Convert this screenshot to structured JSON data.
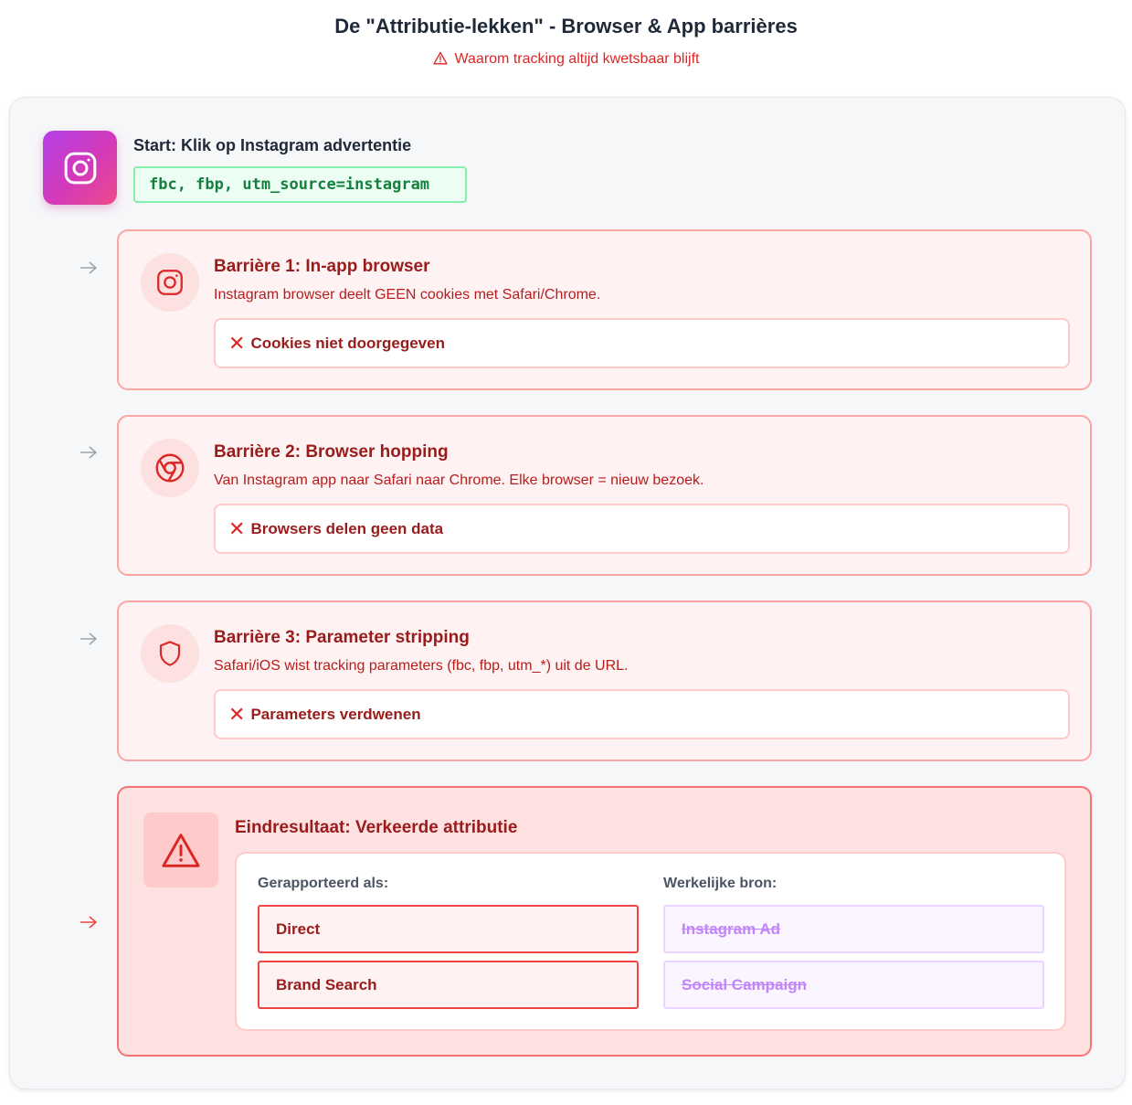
{
  "header": {
    "title": "De \"Attributie-lekken\" - Browser & App barrières",
    "subtitle": "Waarom tracking altijd kwetsbaar blijft"
  },
  "start": {
    "title": "Start: Klik op Instagram advertentie",
    "params": "fbc, fbp, utm_source=instagram",
    "icon": "instagram-icon"
  },
  "barriers": [
    {
      "title": "Barrière 1: In-app browser",
      "description": "Instagram browser deelt GEEN cookies met Safari/Chrome.",
      "result": "Cookies niet doorgegeven",
      "icon": "instagram-icon"
    },
    {
      "title": "Barrière 2: Browser hopping",
      "description": "Van Instagram app naar Safari naar Chrome. Elke browser = nieuw bezoek.",
      "result": "Browsers delen geen data",
      "icon": "chrome-icon"
    },
    {
      "title": "Barrière 3: Parameter stripping",
      "description": "Safari/iOS wist tracking parameters (fbc, fbp, utm_*) uit de URL.",
      "result": "Parameters verdwenen",
      "icon": "shield-icon"
    }
  ],
  "outcome": {
    "title": "Eindresultaat: Verkeerde attributie",
    "reported_label": "Gerapporteerd als:",
    "reported": [
      "Direct",
      "Brand Search"
    ],
    "actual_label": "Werkelijke bron:",
    "actual": [
      "Instagram Ad",
      "Social Campaign"
    ],
    "icon": "warning-icon"
  },
  "colors": {
    "accent_red": "#dc2626",
    "dark_red": "#991b1b",
    "green": "#15803d",
    "purple": "#c084fc"
  }
}
